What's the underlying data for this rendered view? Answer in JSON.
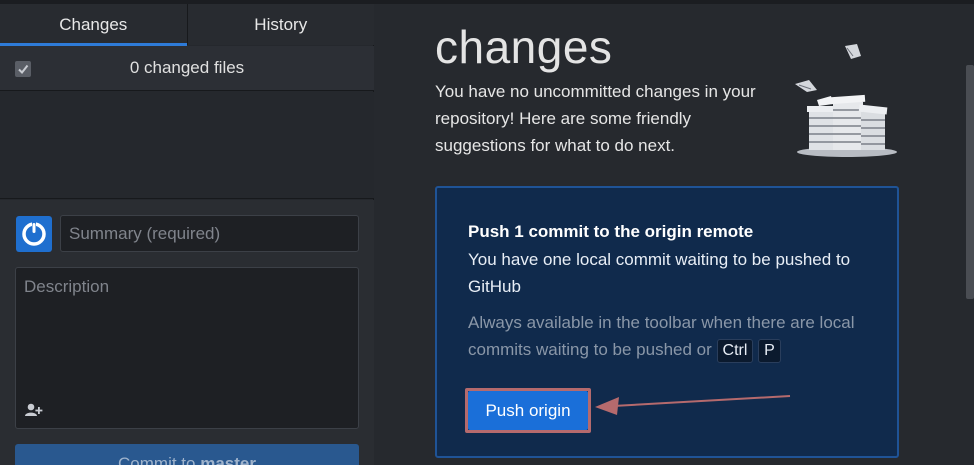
{
  "tabs": [
    {
      "label": "Changes",
      "active": true
    },
    {
      "label": "History",
      "active": false
    }
  ],
  "changes": {
    "summary_text": "0 changed files",
    "select_all_checked": true
  },
  "commit": {
    "summary_placeholder": "Summary (required)",
    "description_placeholder": "Description",
    "button_prefix": "Commit to",
    "branch": "master",
    "avatar_icon": "github-user-icon",
    "coauthor_icon": "add-coauthor-icon"
  },
  "main": {
    "heading": "changes",
    "intro": "You have no uncommitted changes in your repository! Here are some friendly suggestions for what to do next.",
    "illustration_icon": "paper-stack-illustration",
    "card": {
      "title": "Push 1 commit to the origin remote",
      "description": "You have one local commit waiting to be pushed to GitHub",
      "hint_text": "Always available in the toolbar when there are local commits waiting to be pushed or",
      "shortcut_keys": [
        "Ctrl",
        "P"
      ],
      "button_label": "Push origin"
    }
  },
  "colors": {
    "accent": "#2e7bd8",
    "card_bg": "#102a4c",
    "card_border": "#1f5396",
    "push_button": "#1a6fd9",
    "annotation": "#b56a6d"
  }
}
